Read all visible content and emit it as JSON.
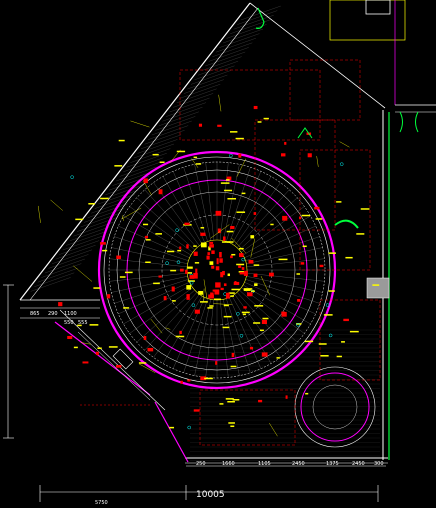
{
  "drawing": {
    "overall_dimension": "10005",
    "bottom_left_dimension": "5750",
    "bottom_dimensions": [
      "250",
      "1660",
      "1105",
      "2450",
      "1375",
      "2450",
      "300"
    ],
    "left_small_dimensions": [
      "865",
      "290",
      "1100",
      "550",
      "555"
    ],
    "colors": {
      "background": "#000000",
      "outline": "#ffffff",
      "hatch": "#c0c0c0",
      "wall": "#00ff3c",
      "ring": "#ff00ff",
      "annotation": "#ffff00",
      "fixture": "#ff0000",
      "accent": "#00ffff"
    }
  }
}
